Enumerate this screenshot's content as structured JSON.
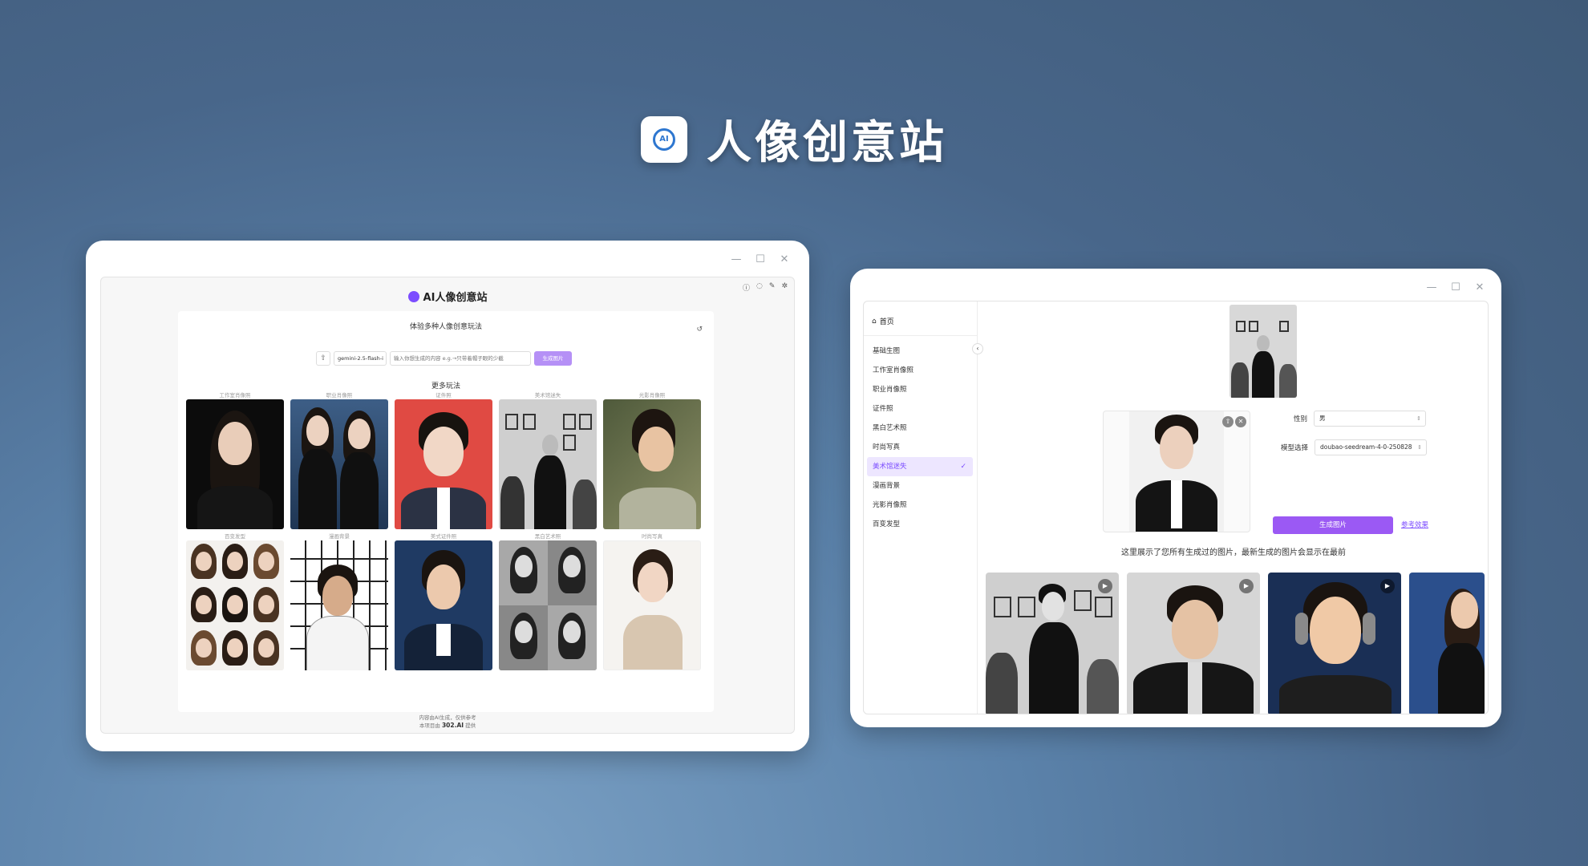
{
  "hero": {
    "title": "人像创意站",
    "logo_text": "AI"
  },
  "left_window": {
    "brand": "AI人像创意站",
    "subtitle": "体验多种人像创意玩法",
    "model_value": "gemini-2.5-flash-i",
    "prompt_placeholder": "输入你想生成的内容 e.g.→只带着帽子眼的少截",
    "generate_label": "生成图片",
    "more_label": "更多玩法",
    "cards": [
      {
        "label": "工作室肖像照"
      },
      {
        "label": "职业肖像照"
      },
      {
        "label": "证件照"
      },
      {
        "label": "美术馆迷失"
      },
      {
        "label": "光影肖像照"
      },
      {
        "label": "百变发型"
      },
      {
        "label": "漫画背景"
      },
      {
        "label": "美式证件照"
      },
      {
        "label": "黑白艺术照"
      },
      {
        "label": "时尚写真"
      }
    ],
    "footer_line1": "内容由AI生成，仅供参考",
    "footer_line2_prefix": "本项目由",
    "footer_brand": "302.AI",
    "footer_line2_suffix": "提供"
  },
  "right_window": {
    "home": "首页",
    "menu": [
      {
        "label": "基础生图"
      },
      {
        "label": "工作室肖像照"
      },
      {
        "label": "职业肖像照"
      },
      {
        "label": "证件照"
      },
      {
        "label": "黑白艺术照"
      },
      {
        "label": "时尚写真"
      },
      {
        "label": "美术馆迷失"
      },
      {
        "label": "漫画背景"
      },
      {
        "label": "光影肖像照"
      },
      {
        "label": "百变发型"
      }
    ],
    "gender_label": "性别",
    "gender_value": "男",
    "model_label": "模型选择",
    "model_value": "doubao-seedream-4-0-250828",
    "generate_label": "生成图片",
    "reference_link": "参考效果",
    "notice": "这里展示了您所有生成过的图片，最新生成的图片会显示在最前"
  },
  "colors": {
    "accent": "#7c4dff",
    "button_purple": "#9b59f4",
    "light_purple": "#b590f6"
  }
}
